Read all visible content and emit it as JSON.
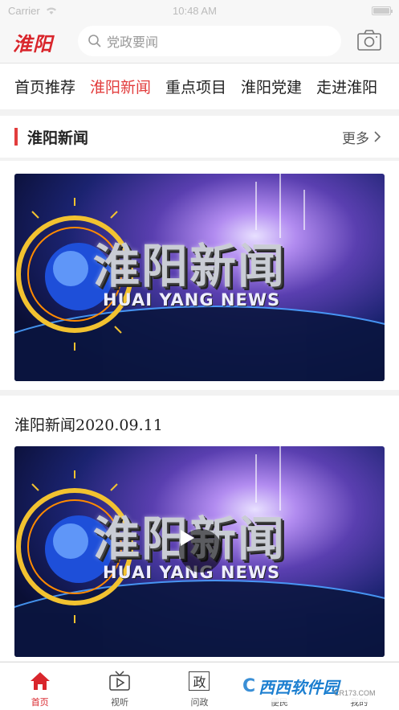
{
  "status_bar": {
    "carrier": "Carrier",
    "time": "10:48 AM",
    "battery_level": 1.0
  },
  "header": {
    "logo": "淮阳",
    "search_placeholder": "党政要闻"
  },
  "tabs": [
    {
      "label": "首页推荐",
      "active": false
    },
    {
      "label": "淮阳新闻",
      "active": true
    },
    {
      "label": "重点项目",
      "active": false
    },
    {
      "label": "淮阳党建",
      "active": false
    },
    {
      "label": "走进淮阳",
      "active": false
    }
  ],
  "section": {
    "title": "淮阳新闻",
    "more": "更多"
  },
  "videos": [
    {
      "caption": "",
      "title_cn": "淮阳新闻",
      "title_en": "HUAI YANG NEWS"
    },
    {
      "caption": "淮阳新闻2020.09.11",
      "title_cn": "淮阳新闻",
      "title_en": "HUAI YANG NEWS"
    }
  ],
  "bottom_nav": [
    {
      "label": "首页",
      "icon": "home-icon",
      "active": true
    },
    {
      "label": "视听",
      "icon": "tv-icon",
      "active": false
    },
    {
      "label": "问政",
      "icon": "zheng-icon",
      "glyph": "政",
      "active": false
    },
    {
      "label": "便民",
      "icon": "service-icon",
      "active": false
    },
    {
      "label": "我的",
      "icon": "user-icon",
      "active": false
    }
  ],
  "watermark": {
    "logo": "C",
    "text": "西西软件园",
    "url": "CR173.COM"
  },
  "colors": {
    "accent": "#e23d3d",
    "brand": "#d9262c"
  }
}
